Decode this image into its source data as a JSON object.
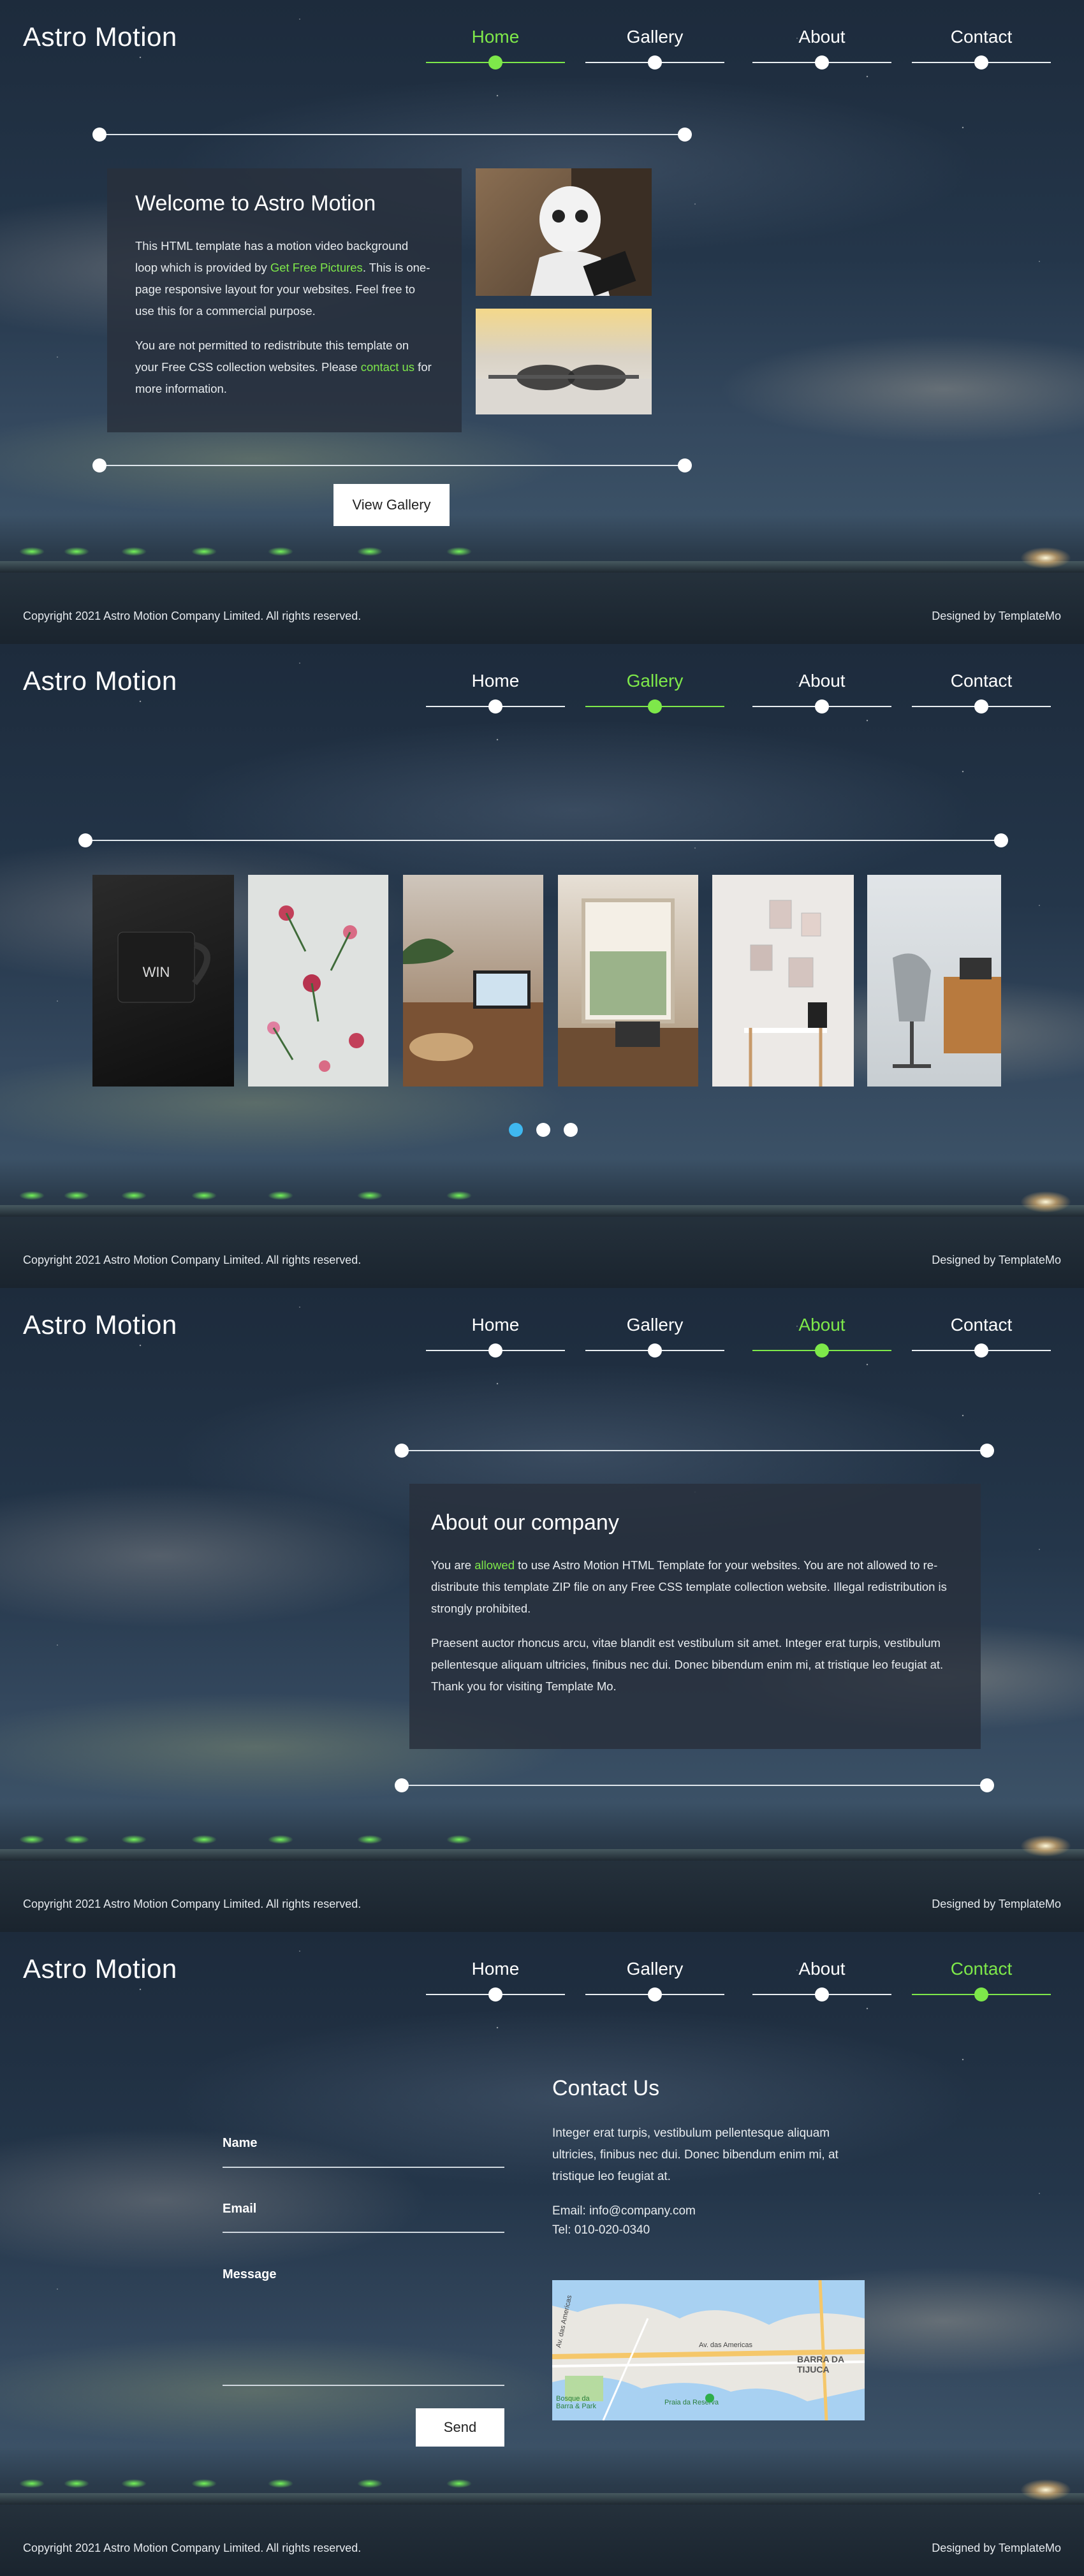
{
  "brand": "Astro Motion",
  "nav": [
    "Home",
    "Gallery",
    "About",
    "Contact"
  ],
  "footer": {
    "copyright": "Copyright 2021 Astro Motion Company Limited. All rights reserved.",
    "designer": "Designed by TemplateMo"
  },
  "colors": {
    "accent": "#7ee84a",
    "gallery_active_dot": "#3fb8f0"
  },
  "home": {
    "title": "Welcome to Astro Motion",
    "p1_pre": "This HTML template has a motion video background loop which is provided by ",
    "p1_link": "Get Free Pictures",
    "p1_post": ". This is one-page responsive layout for your websites. Feel free to use this for a commercial purpose.",
    "p2_pre": "You are not permitted to redistribute this template on your Free CSS collection websites. Please ",
    "p2_link": "contact us",
    "p2_post": " for more information.",
    "button": "View Gallery"
  },
  "gallery": {
    "pages": 3,
    "active_page": 1
  },
  "about": {
    "title": "About our company",
    "p1_pre": "You are ",
    "p1_link": "allowed",
    "p1_post": " to use Astro Motion HTML Template for your websites. You are not allowed to re-distribute this template ZIP file on any Free CSS template collection website. Illegal redistribution is strongly prohibited.",
    "p2": "Praesent auctor rhoncus arcu, vitae blandit est vestibulum sit amet. Integer erat turpis, vestibulum pellentesque aliquam ultricies, finibus nec dui. Donec bibendum enim mi, at tristique leo feugiat at. Thank you for visiting Template Mo."
  },
  "contact": {
    "form": {
      "name_label": "Name",
      "email_label": "Email",
      "message_label": "Message",
      "send": "Send"
    },
    "title": "Contact Us",
    "text": "Integer erat turpis, vestibulum pellentesque aliquam ultricies, finibus nec dui. Donec bibendum enim mi, at tristique leo feugiat at.",
    "email": "Email: info@company.com",
    "tel": "Tel: 010-020-0340",
    "map": {
      "district": "BARRA DA TIJUCA",
      "road1": "Av. das Americas",
      "road2": "Av. das Americas",
      "poi": "Praia da Reserva",
      "park": "Bosque da Barra & Park"
    }
  }
}
